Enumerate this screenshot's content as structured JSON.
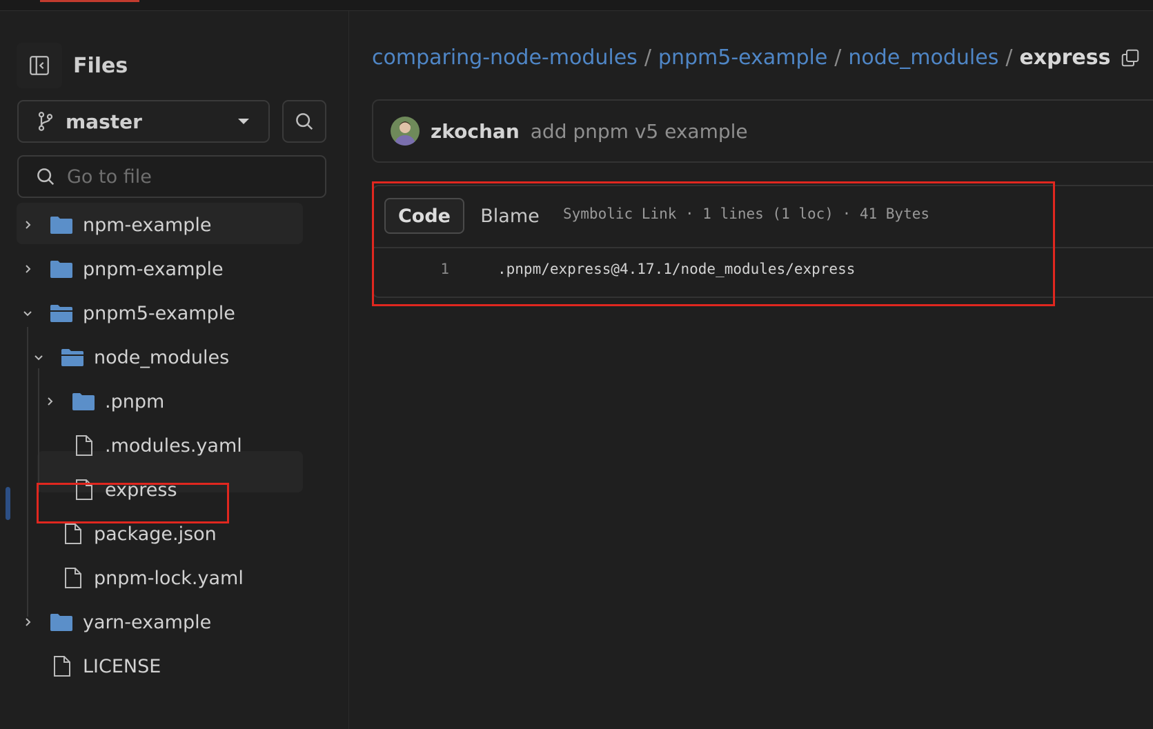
{
  "sidebar": {
    "title": "Files",
    "branch": "master",
    "goto_placeholder": "Go to file",
    "tree": [
      {
        "label": "npm-example",
        "type": "folder",
        "state": "collapsed"
      },
      {
        "label": "pnpm-example",
        "type": "folder",
        "state": "collapsed"
      },
      {
        "label": "pnpm5-example",
        "type": "folder",
        "state": "expanded"
      },
      {
        "label": "node_modules",
        "type": "folder",
        "state": "expanded"
      },
      {
        "label": ".pnpm",
        "type": "folder",
        "state": "collapsed"
      },
      {
        "label": ".modules.yaml",
        "type": "file"
      },
      {
        "label": "express",
        "type": "file",
        "selected": true
      },
      {
        "label": "package.json",
        "type": "file"
      },
      {
        "label": "pnpm-lock.yaml",
        "type": "file"
      },
      {
        "label": "yarn-example",
        "type": "folder",
        "state": "collapsed"
      },
      {
        "label": "LICENSE",
        "type": "file"
      }
    ]
  },
  "breadcrumb": {
    "links": [
      "comparing-node-modules",
      "pnpm5-example",
      "node_modules"
    ],
    "separator": "/",
    "current": "express"
  },
  "commit": {
    "author": "zkochan",
    "message": "add pnpm v5 example"
  },
  "file": {
    "tabs": {
      "code": "Code",
      "blame": "Blame"
    },
    "meta": "Symbolic Link · 1 lines (1 loc) · 41 Bytes",
    "lines": [
      {
        "number": "1",
        "text": ".pnpm/express@4.17.1/node_modules/express"
      }
    ]
  },
  "colors": {
    "background": "#1f1f1f",
    "link": "#4f86c6",
    "folder": "#5b8fc9",
    "highlight_box": "#e0271f"
  }
}
